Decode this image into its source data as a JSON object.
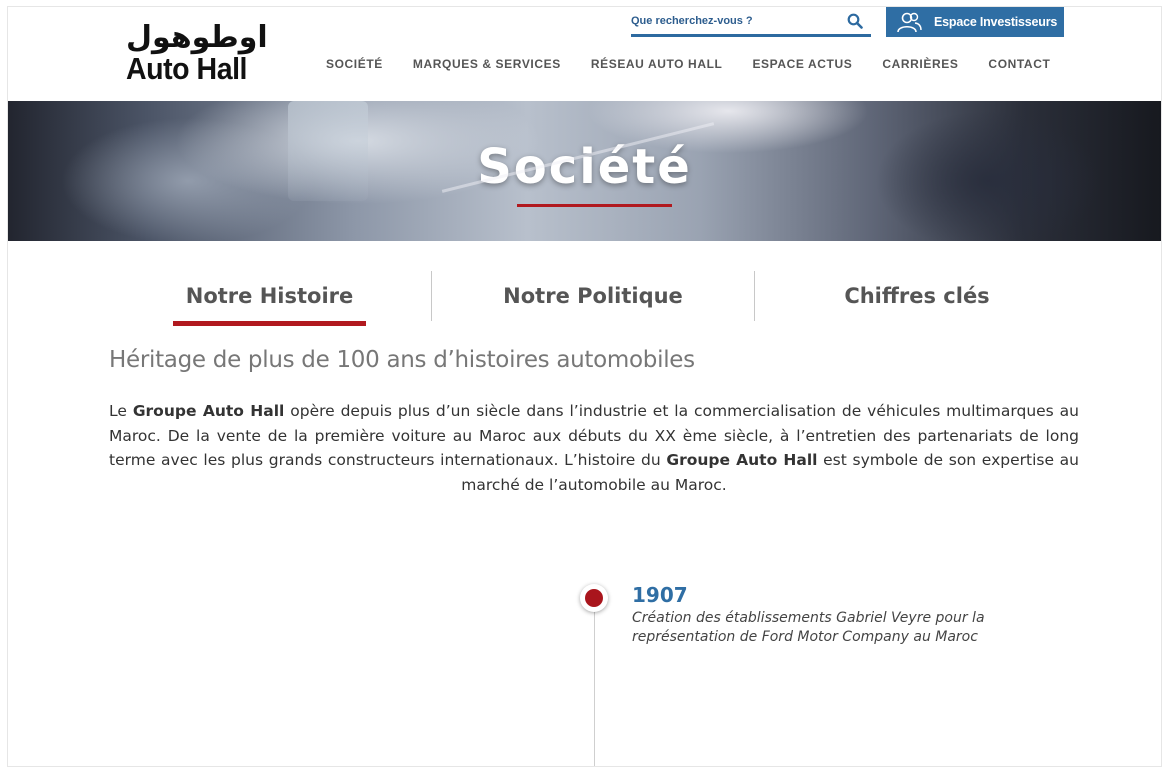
{
  "header": {
    "logo_arabic": "اوطوهول",
    "logo_latin": "Auto Hall",
    "search_placeholder": "Que recherchez-vous ?",
    "investor_button": "Espace Investisseurs",
    "nav": [
      "SOCIÉTÉ",
      "MARQUES & SERVICES",
      "RÉSEAU AUTO HALL",
      "ESPACE ACTUS",
      "CARRIÈRES",
      "CONTACT"
    ]
  },
  "banner": {
    "title": "Société"
  },
  "tabs": [
    {
      "label": "Notre Histoire",
      "active": true
    },
    {
      "label": "Notre Politique",
      "active": false
    },
    {
      "label": "Chiffres clés",
      "active": false
    }
  ],
  "content": {
    "heading": "Héritage de plus de 100 ans d’histoires automobiles",
    "intro": {
      "p1": "Le ",
      "b1": "Groupe Auto Hall",
      "p2": " opère depuis plus d’un siècle dans l’industrie et la commercialisation de véhicules multimarques au Maroc. De la vente de la première voiture au Maroc aux débuts du XX ème siècle, à l’entretien des partenariats de long terme avec les plus grands constructeurs internationaux. L’histoire du ",
      "b2": "Groupe Auto Hall",
      "p3": " est symbole de son expertise au marché de l’automobile au Maroc."
    }
  },
  "timeline": [
    {
      "year": "1907",
      "line1": "Création des établissements Gabriel Veyre pour la",
      "line2": "représentation de Ford Motor Company au Maroc"
    }
  ],
  "colors": {
    "accent_red": "#b1191f",
    "brand_blue": "#2f6ea4"
  }
}
